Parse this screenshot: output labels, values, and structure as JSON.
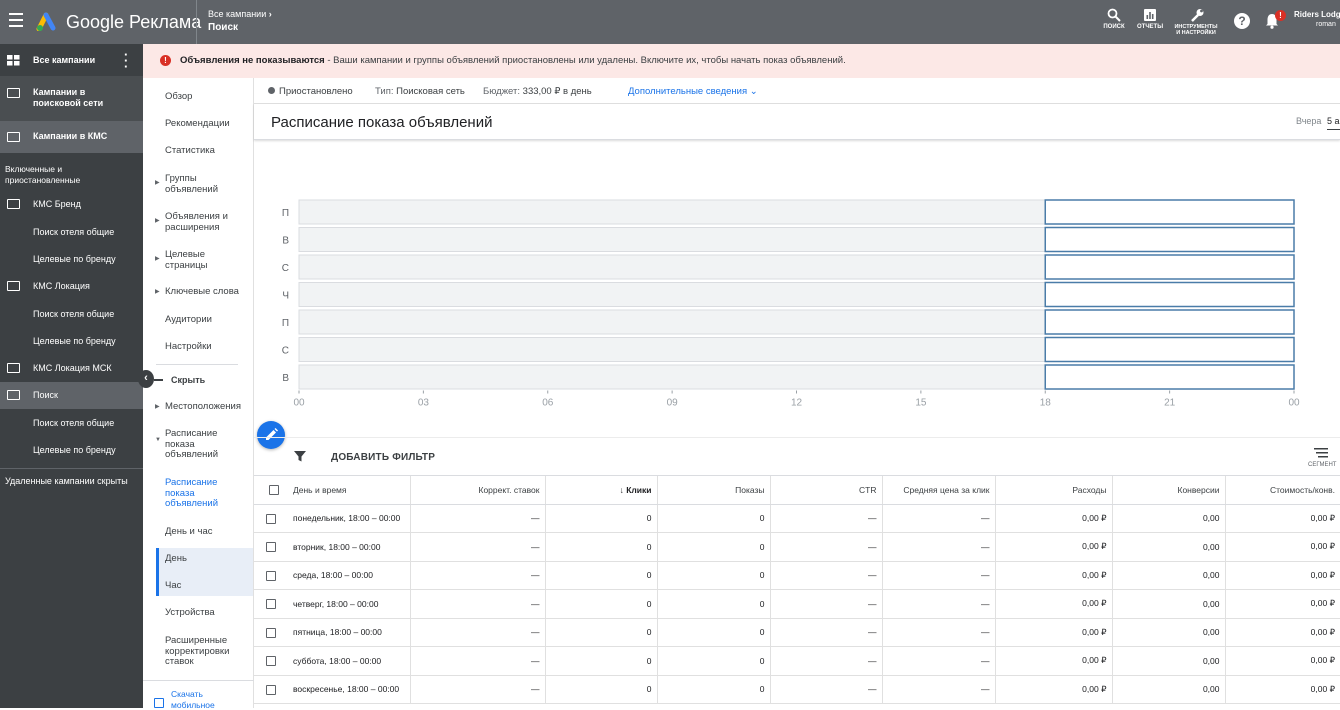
{
  "header": {
    "brand": "Google Реклама",
    "breadcrumb_all": "Все кампании",
    "breadcrumb_current": "Поиск",
    "buttons": {
      "search": "ПОИСК",
      "reports": "ОТЧЕТЫ",
      "tools": "ИНСТРУМЕНТЫ И НАСТРОЙКИ"
    },
    "notification_badge": "!",
    "account_name": "Riders Lodge",
    "account_sub": "roman"
  },
  "sidebar": {
    "all_campaigns": "Все кампании",
    "items": [
      {
        "label": "Кампании в поисковой сети"
      },
      {
        "label": "Кампании в КМС"
      },
      {
        "label": "Включенные и приостановленные"
      },
      {
        "label": "КМС Бренд"
      },
      {
        "label": "Поиск отеля общие"
      },
      {
        "label": "Целевые по бренду"
      },
      {
        "label": "КМС Локация"
      },
      {
        "label": "Поиск отеля общие"
      },
      {
        "label": "Целевые по бренду"
      },
      {
        "label": "КМС Локация МСК"
      },
      {
        "label": "Поиск"
      },
      {
        "label": "Поиск отеля общие"
      },
      {
        "label": "Целевые по бренду"
      },
      {
        "label": "Удаленные кампании скрыты"
      }
    ]
  },
  "subnav": {
    "items": [
      "Обзор",
      "Рекомендации",
      "Статистика",
      "Группы объявлений",
      "Объявления и расширения",
      "Целевые страницы",
      "Ключевые слова",
      "Аудитории",
      "Настройки",
      "Скрыть",
      "Местоположения",
      "Расписание показа объявлений",
      "Расписание показа объявлений",
      "День и час",
      "День",
      "Час",
      "Устройства",
      "Расширенные корректировки ставок",
      "Скачать мобильное"
    ]
  },
  "banner": {
    "bold": "Объявления не показываются",
    "text": " - Ваши кампании и группы объявлений приостановлены или удалены. Включите их, чтобы начать показ объявлений."
  },
  "status": {
    "state": "Приостановлено",
    "type_label": "Тип:",
    "type_value": "Поисковая сеть",
    "budget_label": "Бюджет:",
    "budget_value": "333,00 ₽ в день",
    "details": "Дополнительные сведения"
  },
  "card": {
    "title": "Расписание показа объявлений",
    "period_label": "Вчера",
    "period_value": "5 а"
  },
  "chart_data": {
    "type": "heatmap",
    "rows": [
      "П",
      "В",
      "С",
      "Ч",
      "П",
      "С",
      "В"
    ],
    "x_ticks": [
      "00",
      "03",
      "06",
      "09",
      "12",
      "15",
      "18",
      "21",
      "00"
    ],
    "xlim": [
      0,
      24
    ],
    "scheduled_window": [
      18,
      24
    ],
    "colors": {
      "off": "#f1f3f4",
      "window_border": "#4a7ca8",
      "window_fill": "#ffffff"
    }
  },
  "filter": {
    "add_label": "ДОБАВИТЬ ФИЛЬТР",
    "segment_label": "СЕГМЕНТ"
  },
  "table": {
    "columns": [
      "Дeнь и время",
      "Коррект. ставок",
      "Клики",
      "Показы",
      "CTR",
      "Средняя цена за клик",
      "Расходы",
      "Конверсии",
      "Стоимость/конв."
    ],
    "rows": [
      [
        "понедельник, 18:00 – 00:00",
        "—",
        "0",
        "0",
        "—",
        "—",
        "0,00 ₽",
        "0,00",
        "0,00 ₽"
      ],
      [
        "вторник, 18:00 – 00:00",
        "—",
        "0",
        "0",
        "—",
        "—",
        "0,00 ₽",
        "0,00",
        "0,00 ₽"
      ],
      [
        "среда, 18:00 – 00:00",
        "—",
        "0",
        "0",
        "—",
        "—",
        "0,00 ₽",
        "0,00",
        "0,00 ₽"
      ],
      [
        "четверг, 18:00 – 00:00",
        "—",
        "0",
        "0",
        "—",
        "—",
        "0,00 ₽",
        "0,00",
        "0,00 ₽"
      ],
      [
        "пятница, 18:00 – 00:00",
        "—",
        "0",
        "0",
        "—",
        "—",
        "0,00 ₽",
        "0,00",
        "0,00 ₽"
      ],
      [
        "суббота, 18:00 – 00:00",
        "—",
        "0",
        "0",
        "—",
        "—",
        "0,00 ₽",
        "0,00",
        "0,00 ₽"
      ],
      [
        "воскресенье, 18:00 – 00:00",
        "—",
        "0",
        "0",
        "—",
        "—",
        "0,00 ₽",
        "0,00",
        "0,00 ₽"
      ]
    ]
  }
}
